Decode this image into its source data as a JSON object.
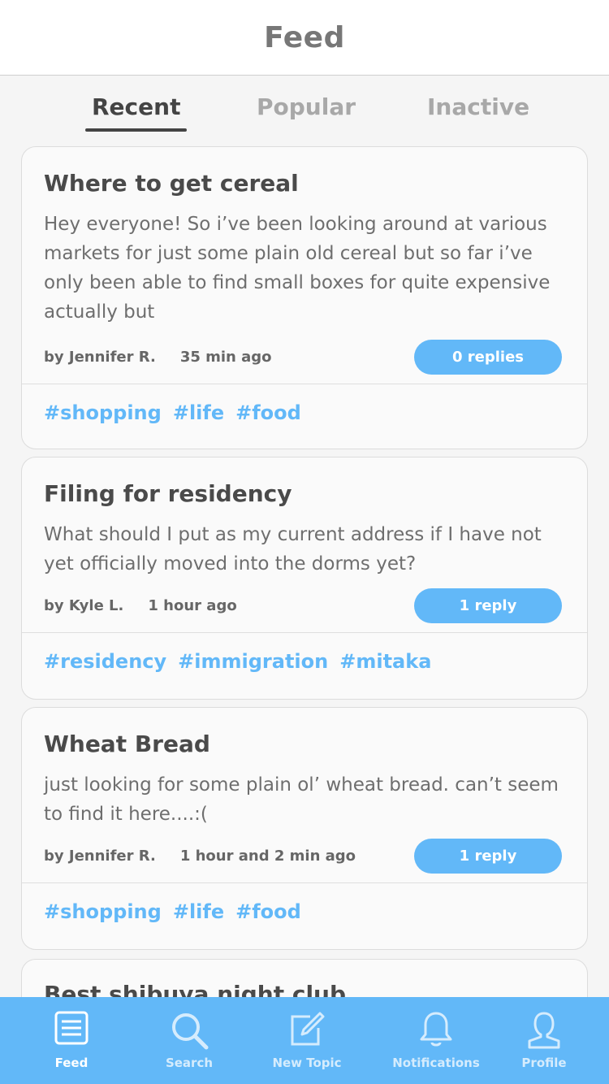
{
  "header": {
    "title": "Feed"
  },
  "tabs": [
    {
      "label": "Recent",
      "active": true
    },
    {
      "label": "Popular",
      "active": false
    },
    {
      "label": "Inactive",
      "active": false
    }
  ],
  "posts": [
    {
      "title": "Where to get cereal",
      "body": "Hey everyone! So i’ve been looking around at various markets for just some plain old cereal but so far i’ve only been able to find small boxes for quite expensive actually but",
      "author": "by Jennifer R.",
      "time": "35 min ago",
      "replies": "0 replies",
      "tags": [
        "#shopping",
        "#life",
        "#food"
      ]
    },
    {
      "title": "Filing for residency",
      "body": "What should I put as my current address if I have not yet officially moved into the dorms yet?",
      "author": "by Kyle L.",
      "time": "1 hour ago",
      "replies": "1 reply",
      "tags": [
        "#residency",
        "#immigration",
        "#mitaka"
      ]
    },
    {
      "title": "Wheat Bread",
      "body": "just looking for some plain ol’ wheat bread. can’t seem to find it here....:(",
      "author": "by Jennifer R.",
      "time": "1 hour and 2 min ago",
      "replies": "1 reply",
      "tags": [
        "#shopping",
        "#life",
        "#food"
      ]
    },
    {
      "title": "Best shibuya night club"
    }
  ],
  "tabbar": [
    {
      "label": "Feed",
      "icon": "feed-icon",
      "active": true
    },
    {
      "label": "Search",
      "icon": "search-icon",
      "active": false
    },
    {
      "label": "New Topic",
      "icon": "new-topic-icon",
      "active": false
    },
    {
      "label": "Notifications",
      "icon": "bell-icon",
      "active": false
    },
    {
      "label": "Profile",
      "icon": "profile-icon",
      "active": false
    }
  ],
  "colors": {
    "accent": "#62b8f8",
    "title_gray": "#777777",
    "text_dark": "#444444"
  }
}
